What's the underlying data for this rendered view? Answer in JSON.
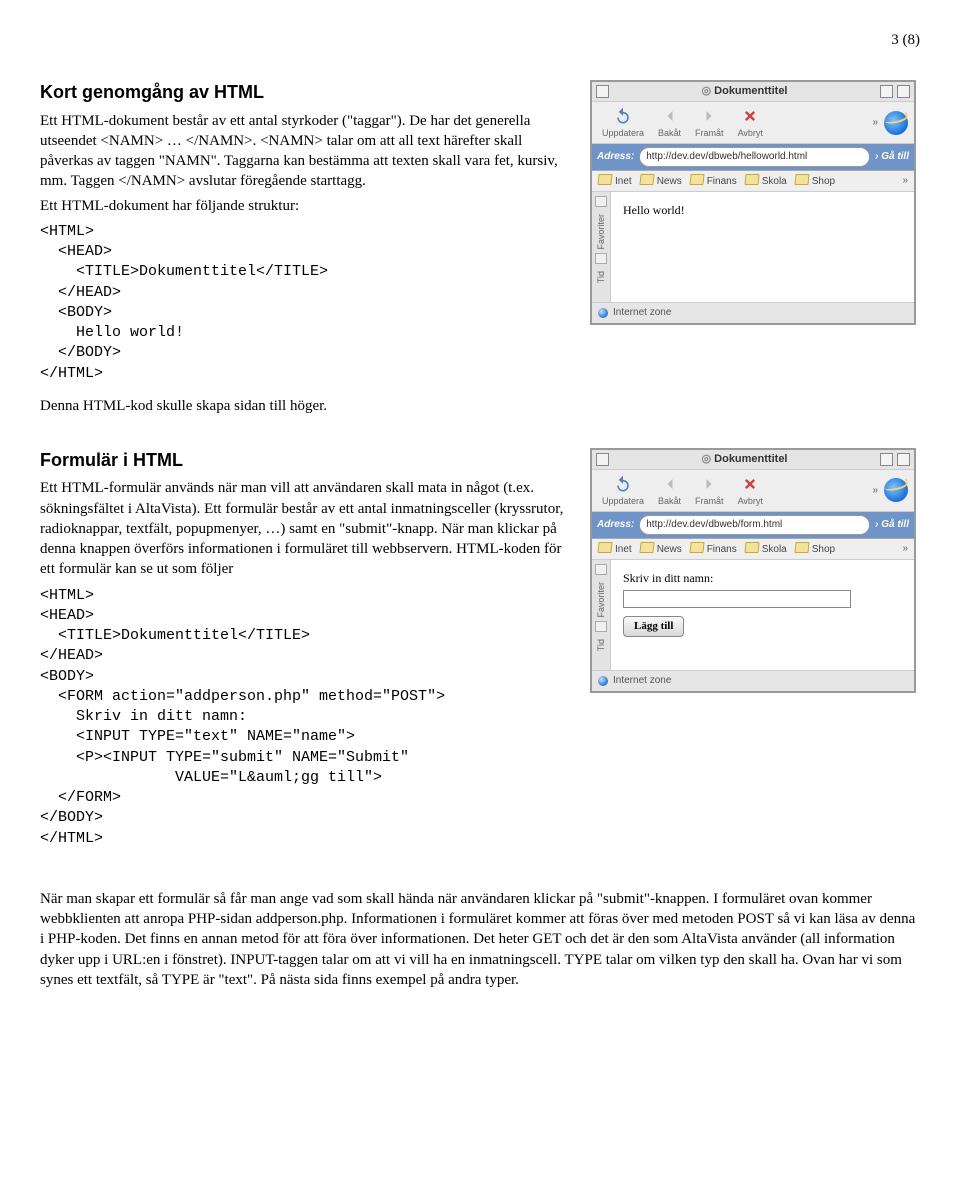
{
  "page_number": "3 (8)",
  "section1": {
    "heading": "Kort genomgång av HTML",
    "para": "Ett HTML-dokument består av ett antal styrkoder (\"taggar\"). De har det generella utseendet <NAMN> … </NAMN>. <NAMN> talar om att all text härefter skall påverkas av taggen \"NAMN\". Taggarna kan bestämma att texten skall vara fet, kursiv, mm. Taggen </NAMN> avslutar föregående starttagg.",
    "para2": "Ett HTML-dokument har följande struktur:",
    "code": "<HTML>\n  <HEAD>\n    <TITLE>Dokumenttitel</TITLE>\n  </HEAD>\n  <BODY>\n    Hello world!\n  </BODY>\n</HTML>",
    "after": "Denna HTML-kod skulle skapa sidan till höger."
  },
  "section2": {
    "heading": "Formulär i HTML",
    "para": "Ett HTML-formulär används när man vill att användaren skall mata in något (t.ex. sökningsfältet i AltaVista). Ett formulär består av ett antal inmatningsceller (kryssrutor, radioknappar, textfält, popupmenyer, …) samt en \"submit\"-knapp. När man klickar på denna knappen överförs informationen i formuläret till webbservern. HTML-koden för ett formulär kan se ut som följer",
    "code": "<HTML>\n<HEAD>\n  <TITLE>Dokumenttitel</TITLE>\n</HEAD>\n<BODY>\n  <FORM action=\"addperson.php\" method=\"POST\">\n    Skriv in ditt namn:\n    <INPUT TYPE=\"text\" NAME=\"name\">\n    <P><INPUT TYPE=\"submit\" NAME=\"Submit\"\n               VALUE=\"L&auml;gg till\">\n  </FORM>\n</BODY>\n</HTML>"
  },
  "final_para": "När man skapar ett formulär så får man ange vad som skall hända när användaren klickar på \"submit\"-knappen. I formuläret ovan kommer webbklienten att anropa PHP-sidan addperson.php. Informationen i formuläret kommer att föras över med metoden POST så vi kan läsa av denna i PHP-koden. Det finns en annan metod för att föra över informationen. Det heter GET och det är den som AltaVista använder (all information dyker upp i URL:en i fönstret). INPUT-taggen talar om att vi vill ha en inmatningscell. TYPE talar om vilken typ den skall ha. Ovan har vi som synes ett textfält, så TYPE är \"text\". På nästa sida finns exempel på andra typer.",
  "browser": {
    "title": "Dokumenttitel",
    "toolbar": {
      "refresh": "Uppdatera",
      "back": "Bakåt",
      "forward": "Framåt",
      "stop": "Avbryt"
    },
    "address_label": "Adress:",
    "go": "Gå till",
    "bookmarks": [
      "Inet",
      "News",
      "Finans",
      "Skola",
      "Shop"
    ],
    "sidebar": {
      "fav": "Favoriter",
      "tid": "Tid"
    },
    "status": "Internet zone"
  },
  "browser1": {
    "url": "http://dev.dev/dbweb/helloworld.html",
    "content_text": "Hello world!"
  },
  "browser2": {
    "url": "http://dev.dev/dbweb/form.html",
    "label": "Skriv in ditt namn:",
    "button": "Lägg till"
  }
}
